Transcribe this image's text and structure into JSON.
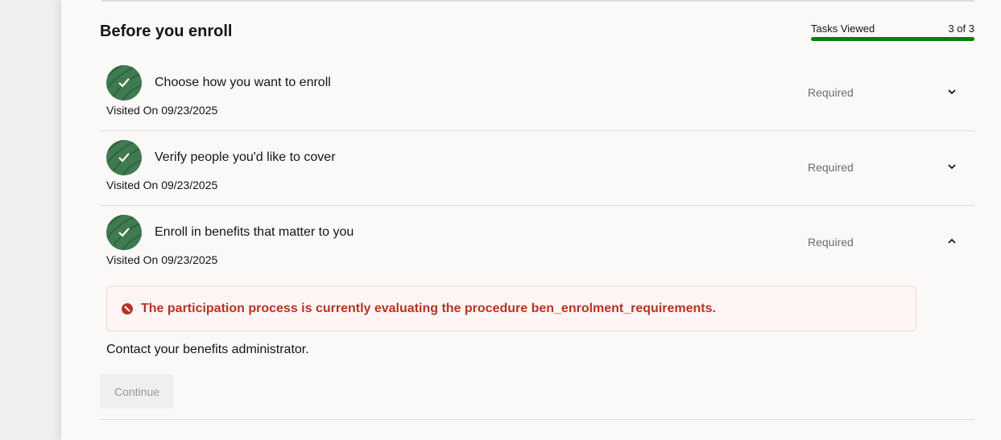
{
  "section": {
    "title": "Before you enroll"
  },
  "progress": {
    "label": "Tasks Viewed",
    "value_text": "3 of 3",
    "fraction": 1.0,
    "color": "#0a7f0a"
  },
  "tasks": [
    {
      "title": "Choose how you want to enroll",
      "visited": "Visited On 09/23/2025",
      "status": "Required",
      "expanded": false
    },
    {
      "title": "Verify people you'd like to cover",
      "visited": "Visited On 09/23/2025",
      "status": "Required",
      "expanded": false
    },
    {
      "title": "Enroll in benefits that matter to you",
      "visited": "Visited On 09/23/2025",
      "status": "Required",
      "expanded": true
    }
  ],
  "error": {
    "message": "The participation process is currently evaluating the procedure ben_enrolment_requirements.",
    "icon": "error-icon",
    "color": "#b33524"
  },
  "contact_text": "Contact your benefits administrator.",
  "continue_label": "Continue"
}
